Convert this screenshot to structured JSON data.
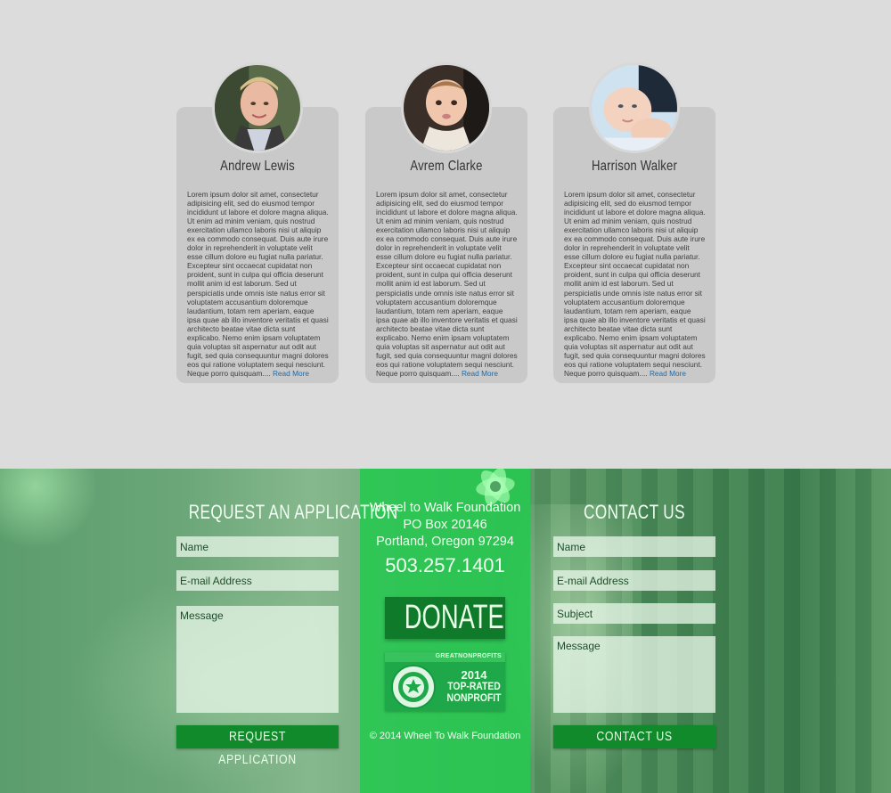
{
  "profiles": [
    {
      "name": "Andrew Lewis",
      "bio": "Lorem ipsum dolor sit amet, consectetur adipisicing elit, sed do eiusmod tempor incididunt ut labore et dolore magna aliqua. Ut enim ad minim veniam, quis nostrud exercitation ullamco laboris nisi ut aliquip ex ea commodo consequat. Duis aute irure dolor in reprehenderit in voluptate velit esse cillum dolore eu fugiat nulla pariatur. Excepteur sint occaecat cupidatat non proident, sunt in culpa qui officia deserunt mollit anim id est laborum. Sed ut perspiciatis unde omnis iste natus error sit voluptatem accusantium doloremque laudantium, totam rem aperiam, eaque ipsa quae ab illo inventore veritatis et quasi architecto beatae vitae dicta sunt explicabo. Nemo enim ipsam voluptatem quia voluptas sit aspernatur aut odit aut fugit, sed quia consequuntur magni dolores eos qui ratione voluptatem sequi nesciunt. Neque porro quisquam....",
      "read_more": "Read More"
    },
    {
      "name": "Avrem Clarke",
      "bio": "Lorem ipsum dolor sit amet, consectetur adipisicing elit, sed do eiusmod tempor incididunt ut labore et dolore magna aliqua. Ut enim ad minim veniam, quis nostrud exercitation ullamco laboris nisi ut aliquip ex ea commodo consequat. Duis aute irure dolor in reprehenderit in voluptate velit esse cillum dolore eu fugiat nulla pariatur. Excepteur sint occaecat cupidatat non proident, sunt in culpa qui officia deserunt mollit anim id est laborum. Sed ut perspiciatis unde omnis iste natus error sit voluptatem accusantium doloremque laudantium, totam rem aperiam, eaque ipsa quae ab illo inventore veritatis et quasi architecto beatae vitae dicta sunt explicabo. Nemo enim ipsam voluptatem quia voluptas sit aspernatur aut odit aut fugit, sed quia consequuntur magni dolores eos qui ratione voluptatem sequi nesciunt. Neque porro quisquam....",
      "read_more": "Read More"
    },
    {
      "name": "Harrison Walker",
      "bio": "Lorem ipsum dolor sit amet, consectetur adipisicing elit, sed do eiusmod tempor incididunt ut labore et dolore magna aliqua. Ut enim ad minim veniam, quis nostrud exercitation ullamco laboris nisi ut aliquip ex ea commodo consequat. Duis aute irure dolor in reprehenderit in voluptate velit esse cillum dolore eu fugiat nulla pariatur. Excepteur sint occaecat cupidatat non proident, sunt in culpa qui officia deserunt mollit anim id est laborum. Sed ut perspiciatis unde omnis iste natus error sit voluptatem accusantium doloremque laudantium, totam rem aperiam, eaque ipsa quae ab illo inventore veritatis et quasi architecto beatae vitae dicta sunt explicabo. Nemo enim ipsam voluptatem quia voluptas sit aspernatur aut odit aut fugit, sed quia consequuntur magni dolores eos qui ratione voluptatem sequi nesciunt. Neque porro quisquam....",
      "read_more": "Read More"
    }
  ],
  "application": {
    "title": "REQUEST AN APPLICATION",
    "name_placeholder": "Name",
    "email_placeholder": "E-mail Address",
    "message_placeholder": "Message",
    "submit_label": "REQUEST APPLICATION"
  },
  "foundation": {
    "name": "Wheel to Walk Foundation",
    "po_box": "PO Box 20146",
    "city": "Portland, Oregon 97294",
    "phone": "503.257.1401",
    "donate_label": "DONATE",
    "badge_org": "GREATNONPROFITS",
    "badge_year": "2014",
    "badge_line1": "TOP-RATED",
    "badge_line2": "NONPROFIT",
    "copyright": "© 2014 Wheel To Walk Foundation"
  },
  "contact": {
    "title": "CONTACT US",
    "name_placeholder": "Name",
    "email_placeholder": "E-mail Address",
    "subject_placeholder": "Subject",
    "message_placeholder": "Message",
    "submit_label": "CONTACT US"
  },
  "colors": {
    "accent": "#26c850",
    "button": "#118a2c",
    "link": "#1c6aa8"
  }
}
